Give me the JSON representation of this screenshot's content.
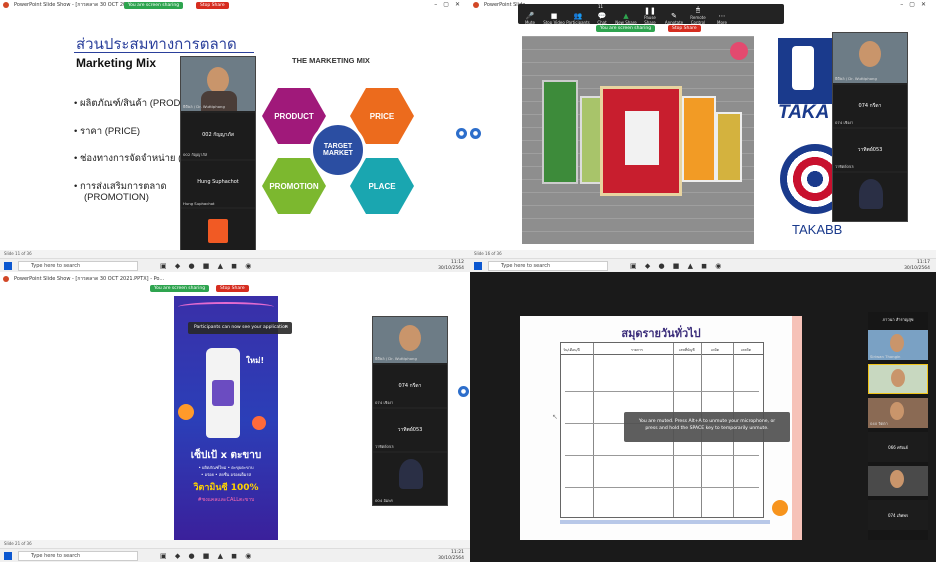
{
  "q1": {
    "window_title": "PowerPoint Slide Show - [การตลาด 30 OCT 2021.PPTX] - Po...",
    "sharing_label": "You are screen sharing",
    "stop_label": "Stop Share",
    "slide_title": "ส่วนประสมทางการตลาด",
    "slide_subtitle": "Marketing Mix",
    "bullets": [
      "ผลิตภัณฑ์/สินค้า (PROD",
      "ราคา (PRICE)",
      "ช่องทางการจัดจำหน่าย (",
      "การส่งเสริมการตลาด",
      "(PROMOTION)"
    ],
    "diagram_title": "THE MARKETING MIX",
    "hexes": {
      "product": "PRODUCT",
      "price": "PRICE",
      "promotion": "PROMOTION",
      "place": "PLACE",
      "center": "TARGET MARKET"
    },
    "participants": [
      {
        "name": "ธิติพล / Dr. Wuttiphong",
        "label": ""
      },
      {
        "name": "002 กัญญาภัส",
        "label": "002 กัญญาภัส"
      },
      {
        "name": "Hung Suphachot",
        "label": "Hung Suphachot"
      },
      {
        "name": "",
        "label": ""
      }
    ],
    "status": "Slide 11 of 36",
    "search": "Type here to search",
    "tray": {
      "time": "11:12",
      "date": "30/10/2564",
      "temp": "29°C"
    }
  },
  "q2": {
    "window_title": "PowerPoint Slide",
    "toolbar": [
      "Mute",
      "Stop Video",
      "Participants",
      "Chat",
      "New Share",
      "Pause Share",
      "Annotate",
      "Remote Control",
      "More"
    ],
    "participant_count": "11",
    "sharing_label": "You are screen sharing",
    "stop_label": "Stop Share",
    "brand_text": "TAKA",
    "brand_text2": "TAKABB",
    "participants": [
      {
        "name": "ธิติพล / Dr. Wuttiphong",
        "label": ""
      },
      {
        "name": "074 เชิงงา",
        "label": "074 กรีดา"
      },
      {
        "name": "วาทิตย์053",
        "label": "วาทิตย์053"
      },
      {
        "name": "",
        "label": ""
      }
    ],
    "status": "Slide 16 of 36",
    "search": "Type here to search",
    "tray": {
      "time": "11:17",
      "date": "30/10/2564",
      "temp": "29°C"
    }
  },
  "q3": {
    "window_title": "PowerPoint Slide Show - [การตลาด 30 OCT 2021.PPTX] - Po...",
    "sharing_label": "You are screen sharing",
    "stop_label": "Stop Share",
    "notice": "Participants can now see your application",
    "ad_new": "ใหม่!",
    "ad_brand": "เซ็ปเป้ x ตะขาบ",
    "ad_small": "• ผลิตภัณฑ์ใหม่ • ตะขุบตะขาบ\n• อร่อย • สดชื่น อร่อยเต็มรส",
    "ad_vitamin": "วิตามินซี 100%",
    "ad_tag": "#ชงแคลเเละCALLตะขาบ",
    "participants": [
      {
        "name": "ธิติพล / Dr. Wuttiphong",
        "label": ""
      },
      {
        "name": "074 เชิงงา",
        "label": "074 กรีดา"
      },
      {
        "name": "วาทิตย์053",
        "label": "วาทิตย์053"
      },
      {
        "name": "004 อัมพร",
        "label": ""
      }
    ],
    "status": "Slide 21 of 36",
    "search": "Type here to search",
    "tray": {
      "time": "11:21",
      "date": "30/10/2564",
      "temp": "29°C"
    }
  },
  "q4": {
    "doc_title": "สมุดรายวันทั่วไป",
    "columns": [
      "วัน/เดือน/ปี",
      "รายการ",
      "เลขที่บัญชี",
      "เดบิต",
      "เครดิต"
    ],
    "muted_msg": "You are muted. Press Alt+A to unmute your microphone, or press and hold the SPACE key to temporarily unmute.",
    "participants": [
      {
        "name": "ภาวนา สำราญสุข",
        "label": "ภาวนา สำราญสุข"
      },
      {
        "name": "Siriwan Thongin",
        "label": ""
      },
      {
        "name": "040 จิตตา",
        "label": ""
      },
      {
        "name": "066 ศรัณย์",
        "label": "066 ศรัณย์"
      },
      {
        "name": "074 เลิศพร",
        "label": "074 เลิศพร"
      }
    ]
  }
}
